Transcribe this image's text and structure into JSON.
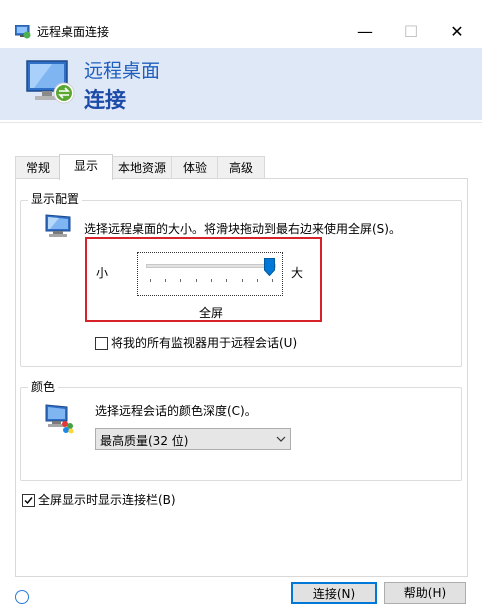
{
  "window": {
    "title": "远程桌面连接",
    "minimize_glyph": "—",
    "maximize_glyph": "☐",
    "close_glyph": "✕"
  },
  "banner": {
    "line1": "远程桌面",
    "line2": "连接"
  },
  "tabs": [
    {
      "label": "常规",
      "active": false
    },
    {
      "label": "显示",
      "active": true
    },
    {
      "label": "本地资源",
      "active": false
    },
    {
      "label": "体验",
      "active": false
    },
    {
      "label": "高级",
      "active": false
    }
  ],
  "display_config": {
    "group_title": "显示配置",
    "description": "选择远程桌面的大小。将滑块拖动到最右边来使用全屏(S)。",
    "slider_min_label": "小",
    "slider_max_label": "大",
    "slider_value_label": "全屏",
    "slider_position": 1.0,
    "multi_monitor_label": "将我的所有监视器用于远程会话(U)",
    "multi_monitor_checked": false
  },
  "colors": {
    "group_title": "颜色",
    "description": "选择远程会话的颜色深度(C)。",
    "selected_depth": "最高质量(32 位)"
  },
  "connection_bar": {
    "label": "全屏显示时显示连接栏(B)",
    "checked": true
  },
  "buttons": {
    "connect": "连接(N)",
    "help": "帮助(H)"
  },
  "accent": {
    "highlight_color": "#d8222a",
    "brand_blue": "#1f5fbf",
    "focus_blue": "#0078d7"
  }
}
